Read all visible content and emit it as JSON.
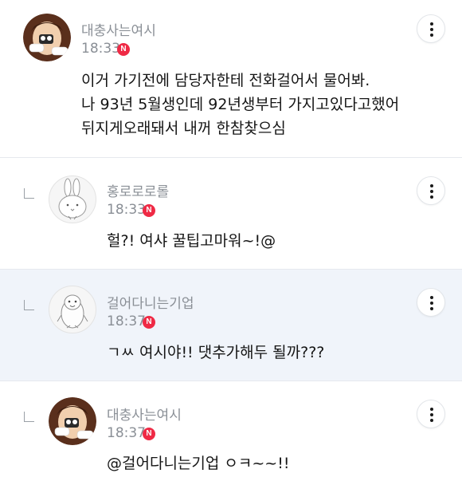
{
  "comments": [
    {
      "author": "대충사는여시",
      "time": "18:33",
      "badge": "N",
      "text": "이거 가기전에 담당자한테 전화걸어서 물어봐.\n나 93년 5월생인데 92년생부터 가지고있다고했어\n뒤지게오래돼서 내꺼 한참찾으심",
      "avatar": "cartoon-woman-avatar",
      "is_reply": false
    },
    {
      "author": "홍로로로롤",
      "time": "18:33",
      "badge": "N",
      "text": "헐?! 여샤 꿀팁고마워~!@",
      "avatar": "bunny-avatar",
      "is_reply": true
    },
    {
      "author": "걸어다니는기업",
      "time": "18:37",
      "badge": "N",
      "text": "ㄱㅆ 여시야!! 댓추가해두 될까???",
      "avatar": "penguin-avatar",
      "is_reply": true
    },
    {
      "author": "대충사는여시",
      "time": "18:37",
      "badge": "N",
      "text": "@걸어다니는기업 ㅇㅋ~~!!",
      "avatar": "cartoon-woman-avatar",
      "is_reply": true
    }
  ],
  "colors": {
    "badge": "#ef2a45",
    "highlight_bg": "#f0f4fa",
    "meta_text": "#8a8f96",
    "divider": "#e6e9ee"
  },
  "icons": {
    "more": "more-vertical-icon",
    "new": "new-badge-icon",
    "reply": "reply-arrow-icon"
  }
}
